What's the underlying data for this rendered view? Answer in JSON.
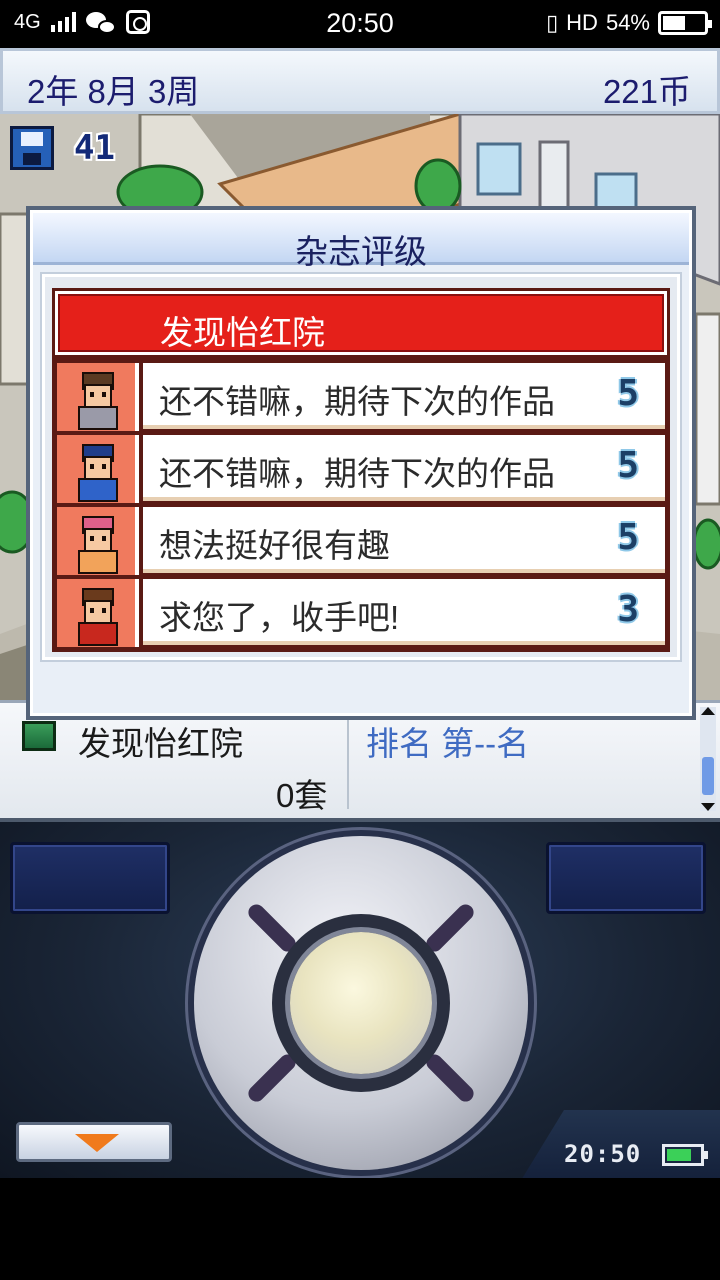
{
  "status_bar": {
    "network": "4G",
    "time": "20:50",
    "hd": "HD",
    "battery_text": "54%",
    "battery_level": 0.54
  },
  "top_bar": {
    "date": "2年 8月 3周",
    "coins": "221币"
  },
  "map": {
    "save_count": "41"
  },
  "dialog": {
    "title": "杂志评级",
    "game_name": "发现怡红院",
    "reviews": [
      {
        "comment": "还不错嘛，期待下次的作品",
        "score": "5",
        "portrait": "reviewer-brown-hair",
        "hair": "#5a3a22",
        "shirt": "#9a9aa8"
      },
      {
        "comment": "还不错嘛，期待下次的作品",
        "score": "5",
        "portrait": "reviewer-blue-cap",
        "hair": "#1f3d8a",
        "shirt": "#2f63c9"
      },
      {
        "comment": "想法挺好很有趣",
        "score": "5",
        "portrait": "reviewer-pink-hair",
        "hair": "#e0608a",
        "shirt": "#f2a35a"
      },
      {
        "comment": "求您了，收手吧!",
        "score": "3",
        "portrait": "reviewer-red-outfit",
        "hair": "#6a3a1c",
        "shirt": "#c8281e"
      }
    ]
  },
  "info": {
    "title": "发现怡红院",
    "count": "0套",
    "rank": "排名 第--名"
  },
  "controller": {
    "clock": "20:50",
    "battery_level": 0.75
  },
  "colors": {
    "accent_red": "#e5201a",
    "portrait_bg": "#f07a5e",
    "text_navy": "#1c1c6e"
  }
}
